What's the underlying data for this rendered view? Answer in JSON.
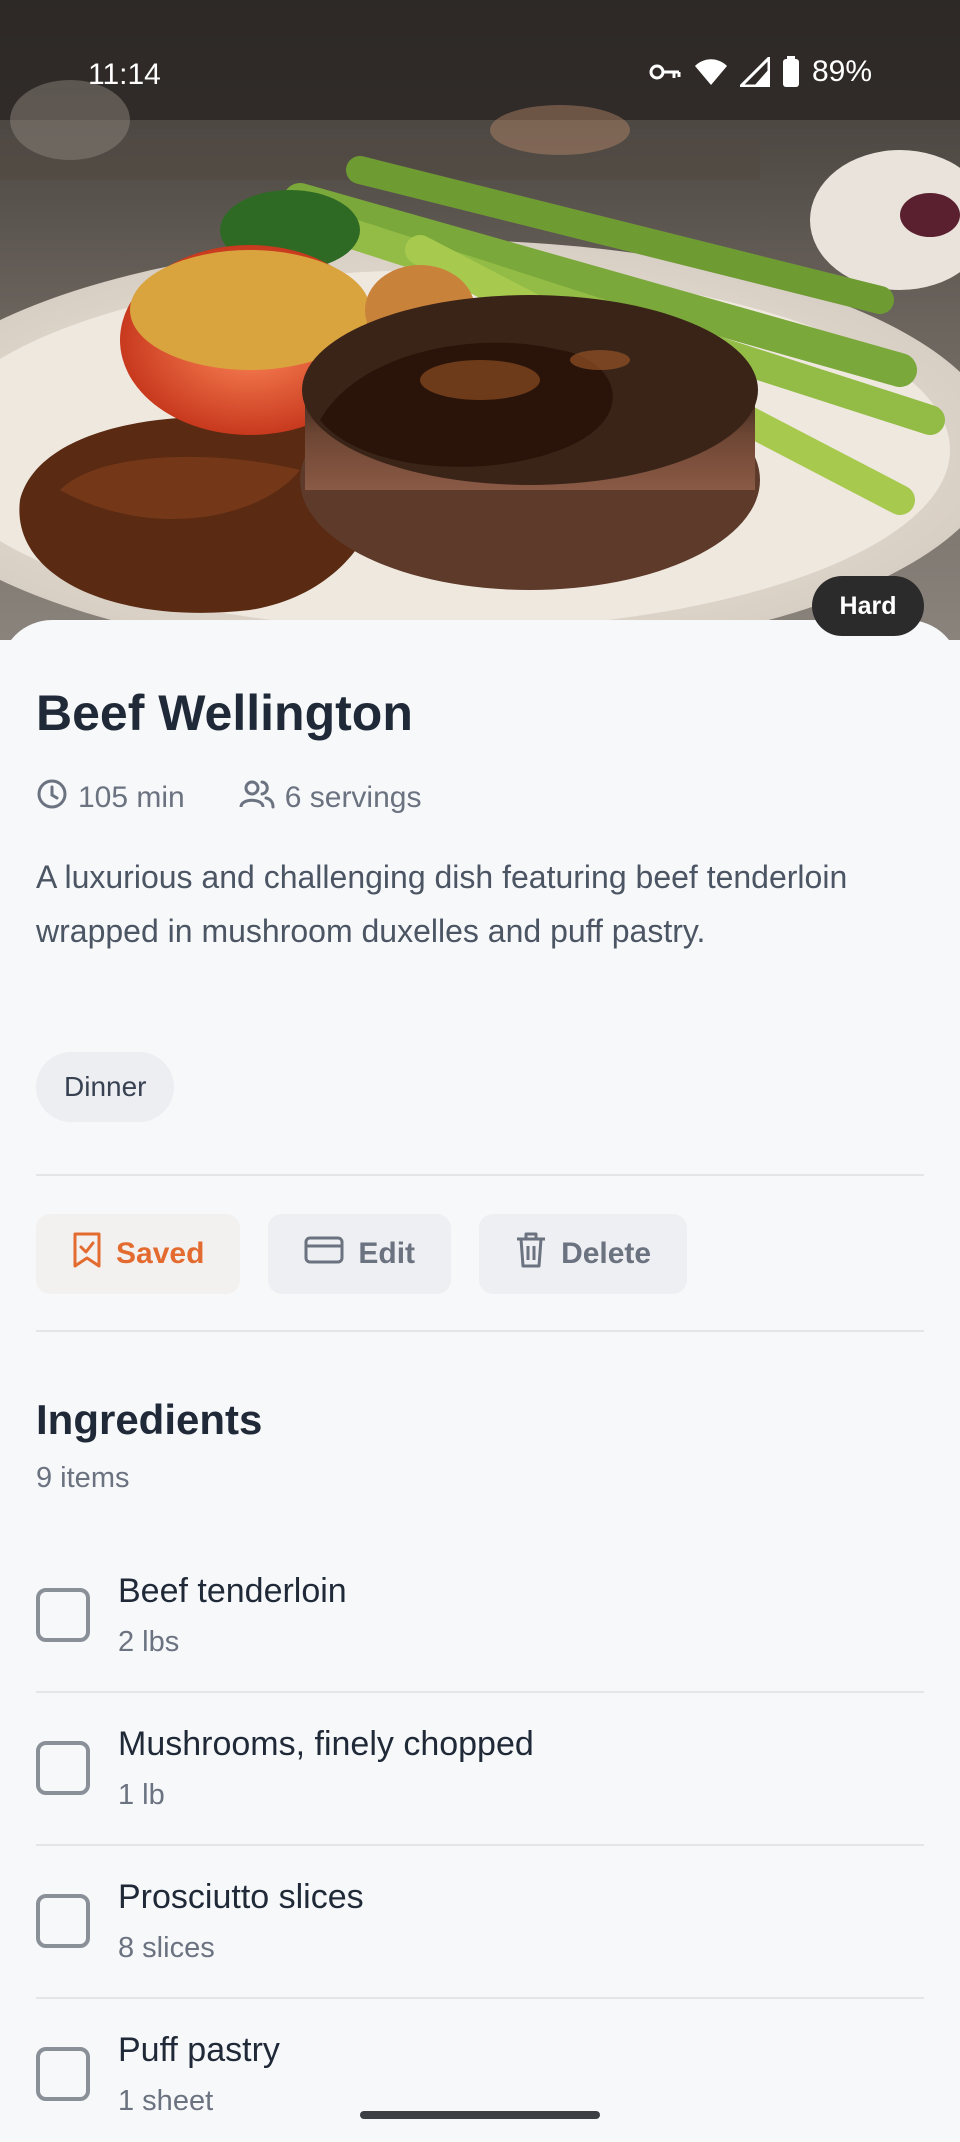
{
  "status_bar": {
    "time": "11:14",
    "battery": "89%",
    "icons": [
      "vpn-key-icon",
      "wifi-icon",
      "signal-icon",
      "battery-icon"
    ]
  },
  "hero": {
    "image_description_icon": "food-photo",
    "difficulty": "Hard"
  },
  "recipe": {
    "title": "Beef Wellington",
    "time": "105 min",
    "servings": "6 servings",
    "description": "A luxurious and challenging dish featuring beef tenderloin wrapped in mushroom duxelles and puff pastry.",
    "tag": "Dinner"
  },
  "actions": {
    "saved_label": "Saved",
    "edit_label": "Edit",
    "delete_label": "Delete",
    "accent_color": "#e36b2f"
  },
  "ingredients": {
    "title": "Ingredients",
    "count": "9 items",
    "items": [
      {
        "name": "Beef tenderloin",
        "qty": "2 lbs"
      },
      {
        "name": "Mushrooms, finely chopped",
        "qty": "1 lb"
      },
      {
        "name": "Prosciutto slices",
        "qty": "8 slices"
      },
      {
        "name": "Puff pastry",
        "qty": "1 sheet"
      }
    ]
  }
}
